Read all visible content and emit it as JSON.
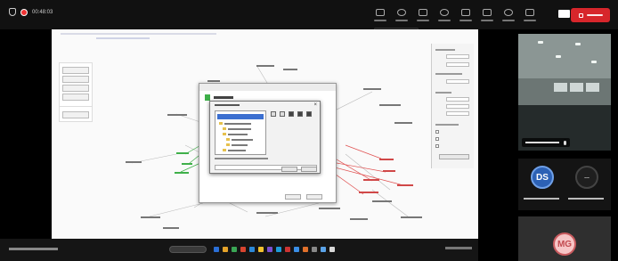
{
  "meeting": {
    "timer": "00:48:03"
  },
  "participants": [
    {
      "initials": "DS",
      "avatar_bg": "#2c61b5"
    },
    {
      "initials": "…",
      "avatar_bg": "#3a3a3a"
    },
    {
      "initials": "MG",
      "avatar_bg": "#f7c6c7"
    }
  ],
  "colors": {
    "leave": "#d7262b",
    "graph_red": "#e05050",
    "graph_green": "#3fb04a",
    "accent_blue": "#1a6fe0"
  }
}
